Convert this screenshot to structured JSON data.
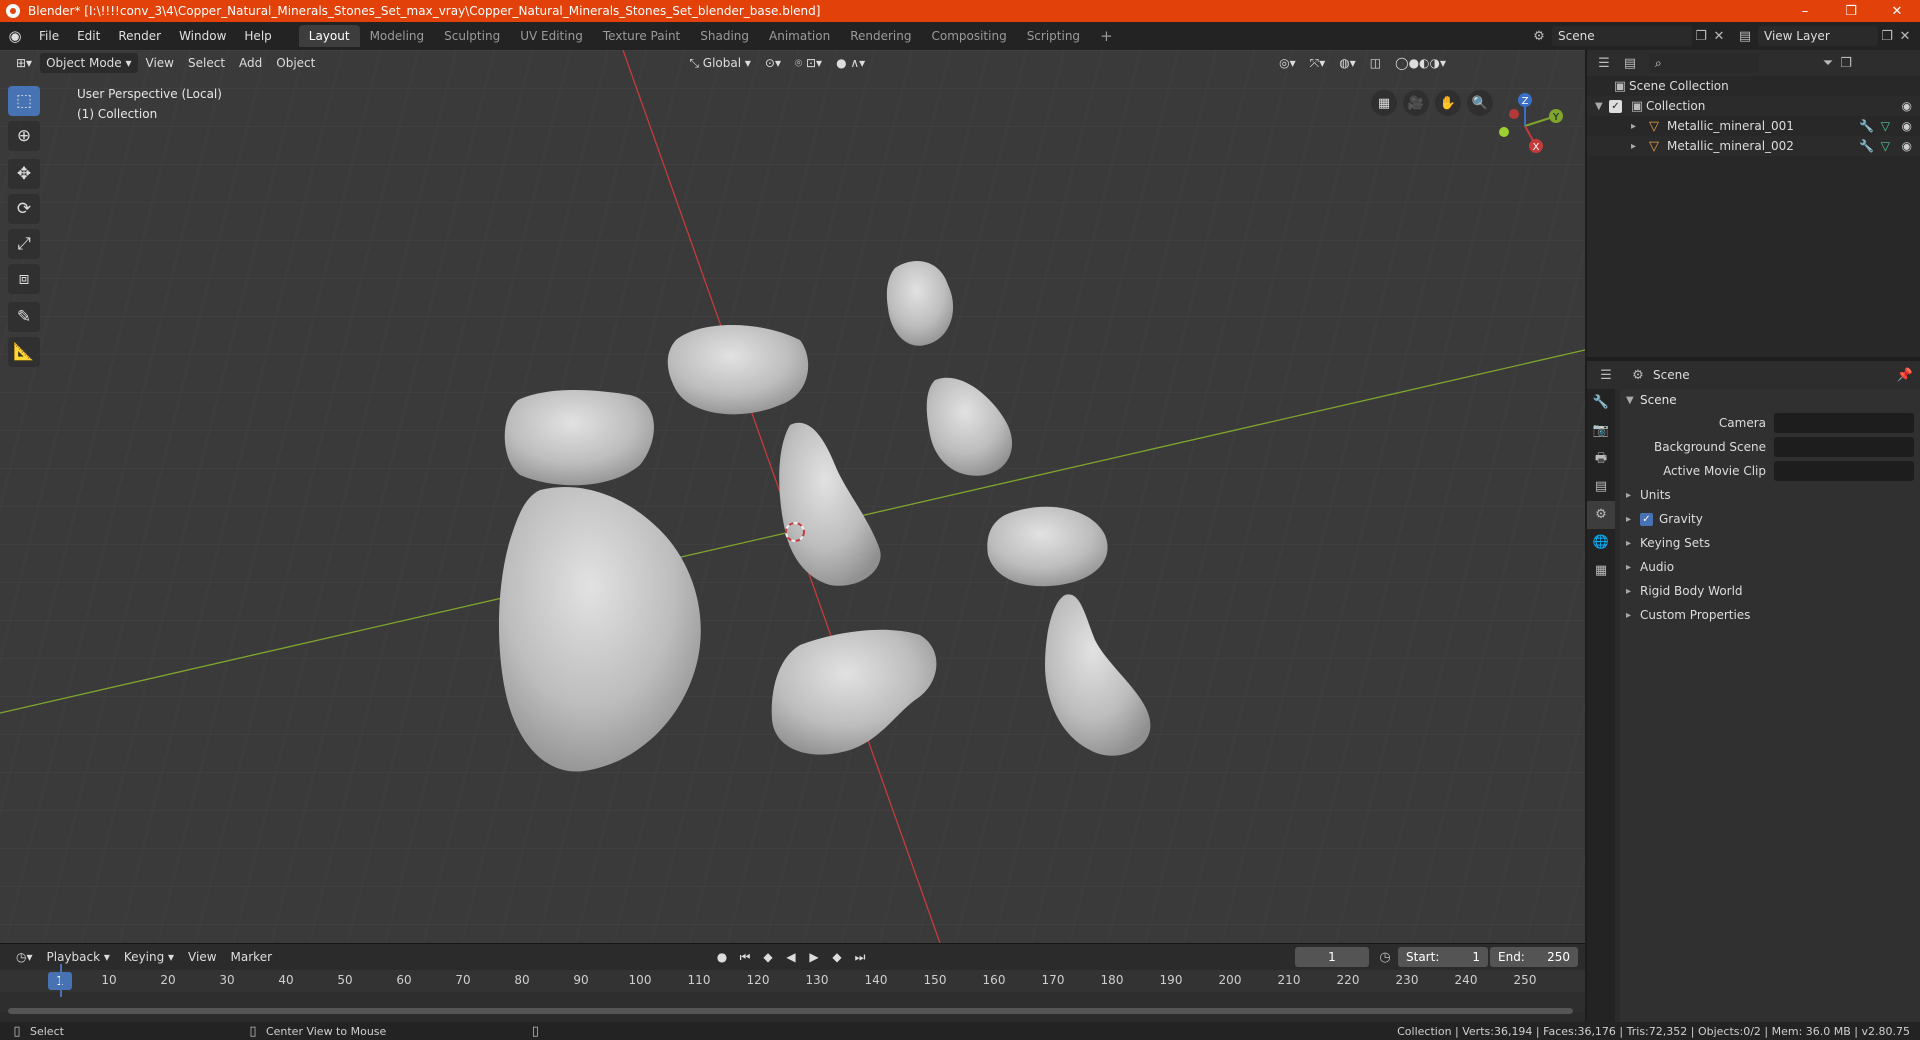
{
  "window": {
    "title": "Blender* [I:\\!!!!conv_3\\4\\Copper_Natural_Minerals_Stones_Set_max_vray\\Copper_Natural_Minerals_Stones_Set_blender_base.blend]",
    "minimize": "–",
    "maximize": "❐",
    "close": "✕"
  },
  "menu": [
    "File",
    "Edit",
    "Render",
    "Window",
    "Help"
  ],
  "workspaces": [
    {
      "label": "Layout",
      "active": true
    },
    {
      "label": "Modeling"
    },
    {
      "label": "Sculpting"
    },
    {
      "label": "UV Editing"
    },
    {
      "label": "Texture Paint"
    },
    {
      "label": "Shading"
    },
    {
      "label": "Animation"
    },
    {
      "label": "Rendering"
    },
    {
      "label": "Compositing"
    },
    {
      "label": "Scripting"
    }
  ],
  "scene_field": "Scene",
  "view_layer_field": "View Layer",
  "viewport": {
    "mode": "Object Mode",
    "menus": [
      "View",
      "Select",
      "Add",
      "Object"
    ],
    "orientation": "Global",
    "info_line1": "User Perspective (Local)",
    "info_line2": "(1) Collection",
    "gizmo": {
      "z": "Z",
      "y": "Y",
      "x": "X"
    }
  },
  "outliner": {
    "scene_collection": "Scene Collection",
    "collection": "Collection",
    "objects": [
      "Metallic_mineral_001",
      "Metallic_mineral_002"
    ]
  },
  "properties": {
    "context": "Scene",
    "panel": "Scene",
    "fields": [
      {
        "label": "Camera"
      },
      {
        "label": "Background Scene"
      },
      {
        "label": "Active Movie Clip"
      }
    ],
    "subpanels": [
      {
        "label": "Units",
        "checkbox": false
      },
      {
        "label": "Gravity",
        "checkbox": true
      },
      {
        "label": "Keying Sets",
        "checkbox": false
      },
      {
        "label": "Audio",
        "checkbox": false
      },
      {
        "label": "Rigid Body World",
        "checkbox": false
      },
      {
        "label": "Custom Properties",
        "checkbox": false
      }
    ]
  },
  "timeline": {
    "menus": [
      "Playback",
      "Keying",
      "View",
      "Marker"
    ],
    "current_frame": "1",
    "start_label": "Start:",
    "start": "1",
    "end_label": "End:",
    "end": "250",
    "ticks": [
      "10",
      "20",
      "30",
      "40",
      "50",
      "60",
      "70",
      "80",
      "90",
      "100",
      "110",
      "120",
      "130",
      "140",
      "150",
      "160",
      "170",
      "180",
      "190",
      "200",
      "210",
      "220",
      "230",
      "240",
      "250"
    ]
  },
  "statusbar": {
    "select": "Select",
    "center_view": "Center View to Mouse",
    "stats": "Collection | Verts:36,194 | Faces:36,176 | Tris:72,352 | Objects:0/2 | Mem: 36.0 MB | v2.80.75"
  },
  "colors": {
    "titlebar": "#e2410a",
    "accent": "#4772b3",
    "viewport_bg": "#3a3a3a",
    "stone": "#c8c8c8",
    "axis_x": "#c43b3b",
    "axis_y": "#7fa52e"
  }
}
